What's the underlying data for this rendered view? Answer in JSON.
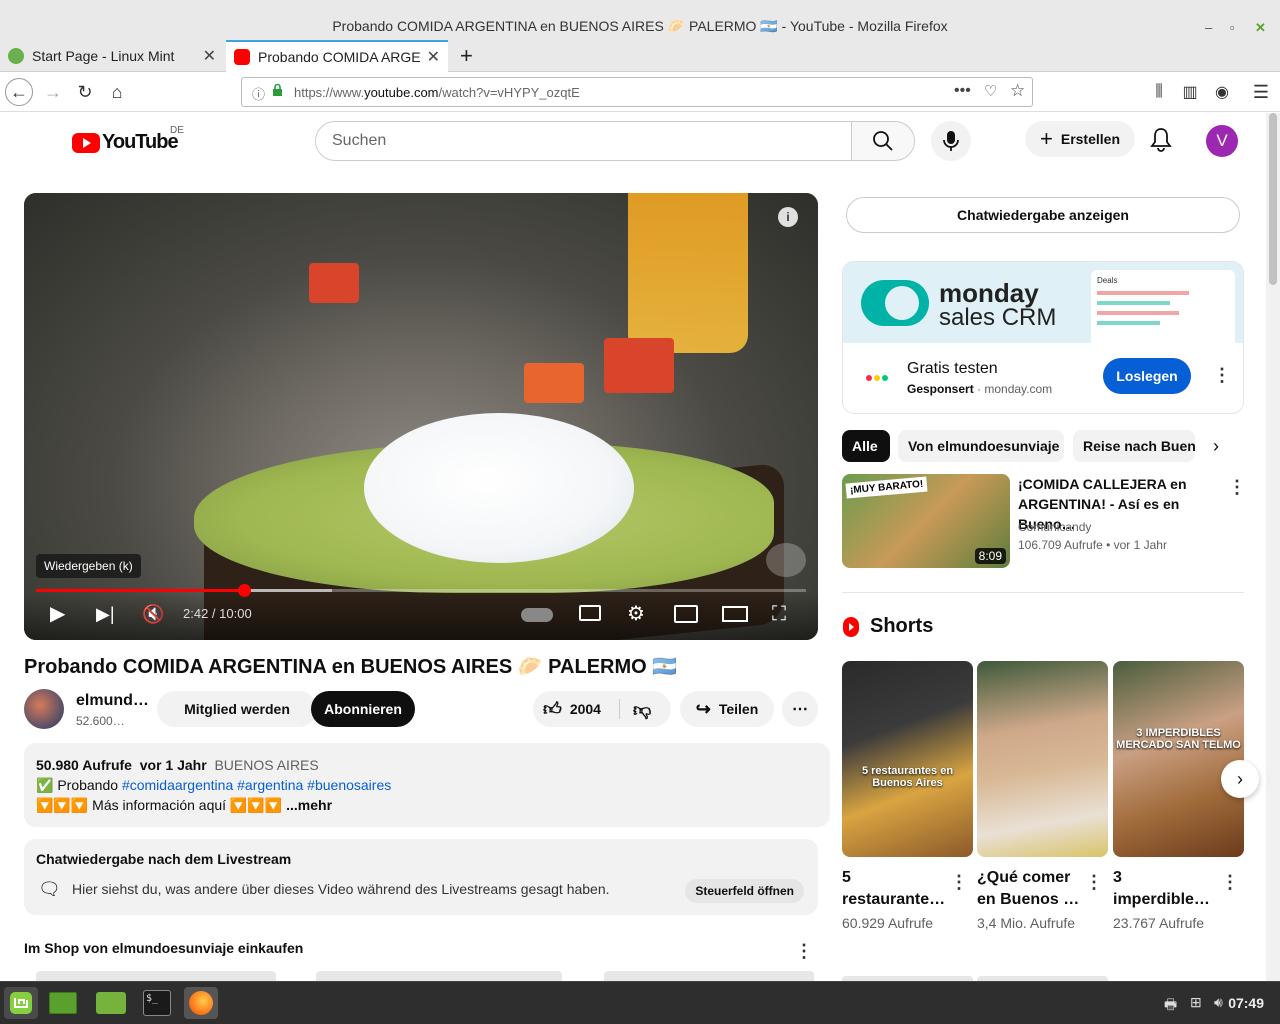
{
  "window": {
    "title": "Probando COMIDA ARGENTINA en BUENOS AIRES 🥟 PALERMO 🇦🇷 - YouTube - Mozilla Firefox"
  },
  "tabs": [
    {
      "label": "Start Page - Linux Mint",
      "active": false
    },
    {
      "label": "Probando COMIDA ARGEN",
      "active": true
    }
  ],
  "urlbar": {
    "prefix": "https://www.",
    "host": "youtube.com",
    "path": "/watch?v=vHYPY_ozqtE"
  },
  "youtube": {
    "logo_text": "YouTube",
    "country": "DE",
    "search_placeholder": "Suchen",
    "create_label": "Erstellen",
    "avatar_letter": "V"
  },
  "player": {
    "tooltip": "Wiedergeben (k)",
    "time": "2:42 / 10:00",
    "played_fraction": 0.27,
    "buffered_fraction": 0.385,
    "info_icon": "i"
  },
  "video": {
    "title": "Probando COMIDA ARGENTINA en BUENOS AIRES 🥟 PALERMO 🇦🇷",
    "channel_name": "elmund…",
    "channel_subs": "52.600…",
    "join_label": "Mitglied werden",
    "subscribe_label": "Abonnieren",
    "likes": "2004",
    "share_label": "Teilen"
  },
  "description": {
    "views": "50.980 Aufrufe",
    "age": "vor 1 Jahr",
    "location": "BUENOS AIRES",
    "line2_prefix": "✅ Probando ",
    "hashtags": "#comidaargentina #argentina #buenosaires",
    "line3": "🔽🔽🔽 Más información aquí 🔽🔽🔽",
    "more": "...mehr"
  },
  "livechat": {
    "title": "Chatwiedergabe nach dem Livestream",
    "text": "Hier siehst du, was andere über dieses Video während des Livestreams gesagt haben.",
    "open_label": "Steuerfeld öffnen"
  },
  "shop": {
    "title": "Im Shop von elmundoesunviaje einkaufen"
  },
  "sidebar": {
    "chat_replay_label": "Chatwiedergabe anzeigen",
    "ad": {
      "brand_line1": "monday",
      "brand_line2": "sales CRM",
      "dash_title": "Deals",
      "cta_title": "Gratis testen",
      "sponsored": "Gesponsert",
      "domain": "monday.com",
      "button": "Loslegen"
    },
    "chips": [
      "Alle",
      "Von elmundoesunviaje",
      "Reise nach Buenos"
    ],
    "recommendation": {
      "title": "¡COMIDA CALLEJERA en ARGENTINA! - Así es en Bueno…",
      "channel": "Comunicandy",
      "meta": "106.709 Aufrufe • vor 1 Jahr",
      "duration": "8:09",
      "badge": "¡MUY BARATO!"
    },
    "shorts_heading": "Shorts",
    "shorts": [
      {
        "title": "5 restaurante…",
        "views": "60.929 Aufrufe",
        "overlay": "5 restaurantes en Buenos Aires"
      },
      {
        "title": "¿Qué comer en Buenos …",
        "views": "3,4 Mio. Aufrufe",
        "overlay": ""
      },
      {
        "title": "3 imperdible…",
        "views": "23.767 Aufrufe",
        "overlay": "3 IMPERDIBLES MERCADO SAN TELMO"
      }
    ]
  },
  "taskbar": {
    "clock": "07:49"
  },
  "colors": {
    "yt_red": "#ff0000",
    "link_blue": "#065fd4",
    "avatar_purple": "#9c27b0",
    "monday_teal": "#00b3a6"
  }
}
